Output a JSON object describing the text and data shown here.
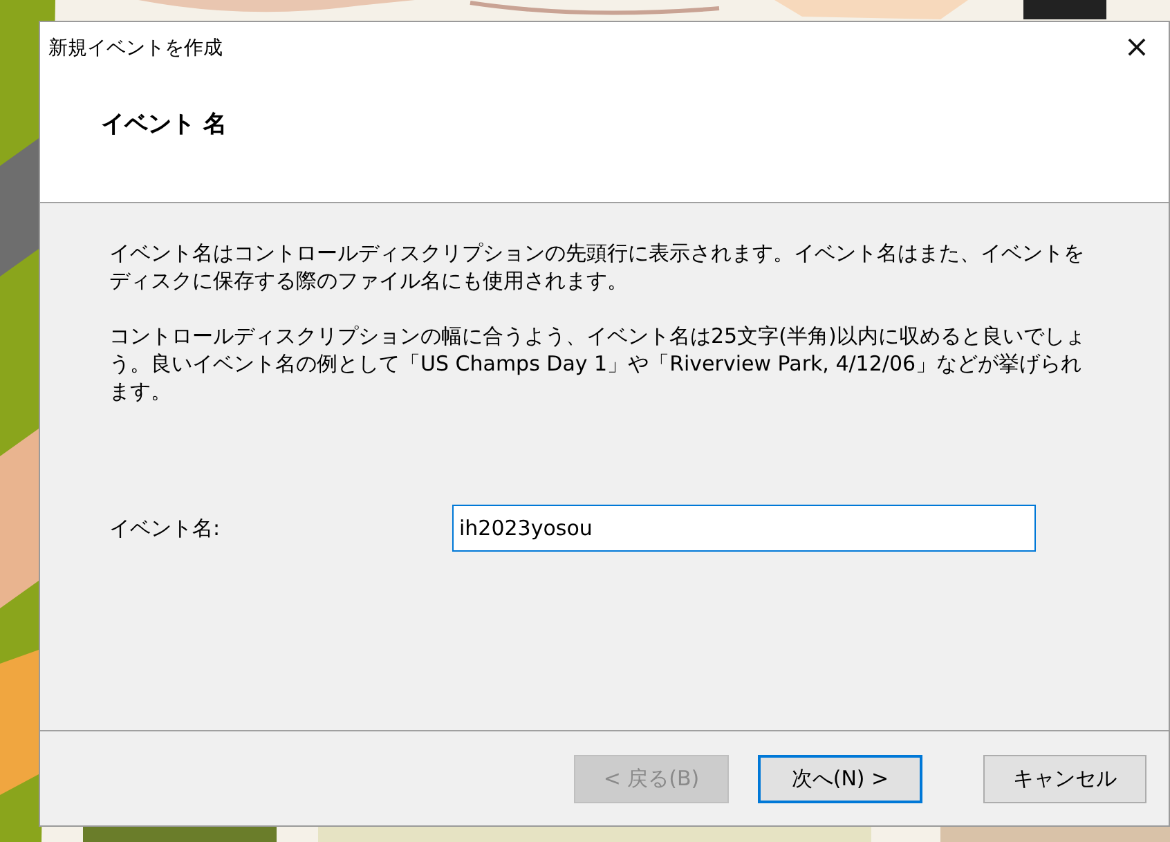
{
  "background": {
    "kind": "picture"
  },
  "window": {
    "title": "新規イベントを作成",
    "close": "×"
  },
  "header": {
    "title": "イベント 名"
  },
  "paragraphs": [
    "イベント名はコントロールディスクリプションの先頭行に表示されます。イベント名はまた、イベントをディスクに保存する際のファイル名にも使用されます。",
    "コントロールディスクリプションの幅に合うよう、イベント名は25文字(半角)以内に収めると良いでしょう。良いイベント名の例として「US Champs Day 1」や「Riverview Park, 4/12/06」などが挙げられます。"
  ],
  "field": {
    "label": "イベント名:",
    "value": "ih2023yosou",
    "focused": true
  },
  "buttons": [
    {
      "label": "< 戻る(B)",
      "disabled": true,
      "default": false
    },
    {
      "label": "次へ(N) >",
      "disabled": false,
      "default": true
    },
    {
      "label": "キャンセル",
      "disabled": false,
      "default": false
    }
  ]
}
